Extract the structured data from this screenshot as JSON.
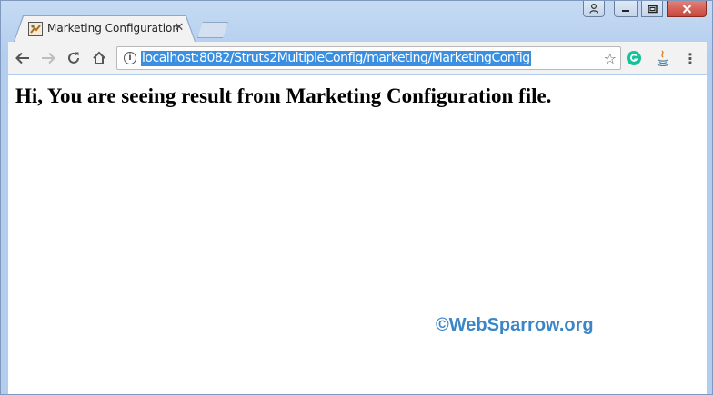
{
  "window": {
    "tab_title": "Marketing Configuration",
    "tab_close": "✕"
  },
  "toolbar": {
    "url": "localhost:8082/Struts2MultipleConfig/marketing/MarketingConfig",
    "info_glyph": "i",
    "star_glyph": "☆",
    "menu_glyph": "⋮"
  },
  "page": {
    "heading": "Hi, You are seeing result from Marketing Configuration file.",
    "watermark": "©WebSparrow.org"
  },
  "colors": {
    "url_highlight": "#3b8fe0",
    "watermark": "#3a86c8",
    "grammarly": "#15c39a"
  }
}
